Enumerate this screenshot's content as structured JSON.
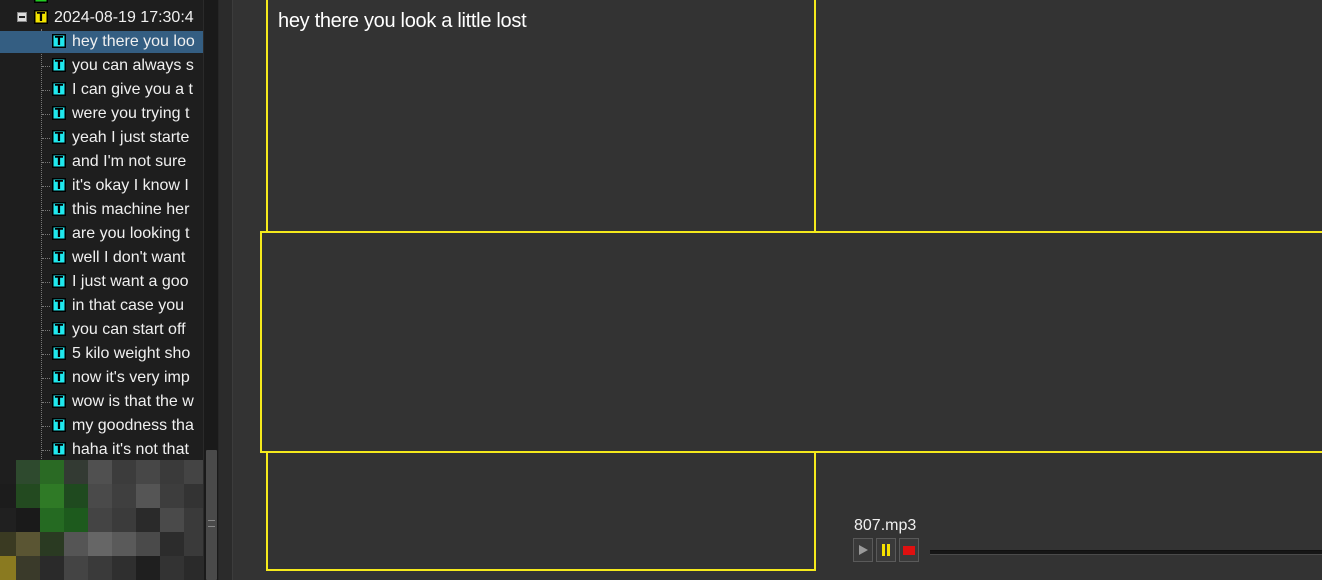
{
  "tree": {
    "parent_label": "2024-08-19 17:30:4",
    "items": [
      "hey there you loo",
      "you can always s",
      "I can give you a t",
      "were you trying t",
      "yeah I just starte",
      "and I'm not sure",
      "it's okay I know I",
      "this machine her",
      "are you looking t",
      "well I don't want",
      "I just want a goo",
      "in that case you",
      "you can start off",
      "5 kilo weight sho",
      "now it's very imp",
      "wow is that the w",
      "my goodness tha",
      "haha it's not that"
    ],
    "selected_index": 0,
    "icon_letter": "T"
  },
  "caption": {
    "text": "hey there you look a little lost"
  },
  "player": {
    "file_name": "807.mp3",
    "play_icon": "play-icon",
    "pause_icon": "pause-icon",
    "stop_icon": "stop-icon"
  },
  "colors": {
    "frame": "#f5ea1c",
    "selection": "#345e82",
    "text_icon": "#20e8ee",
    "group_icon": "#f4e400"
  }
}
